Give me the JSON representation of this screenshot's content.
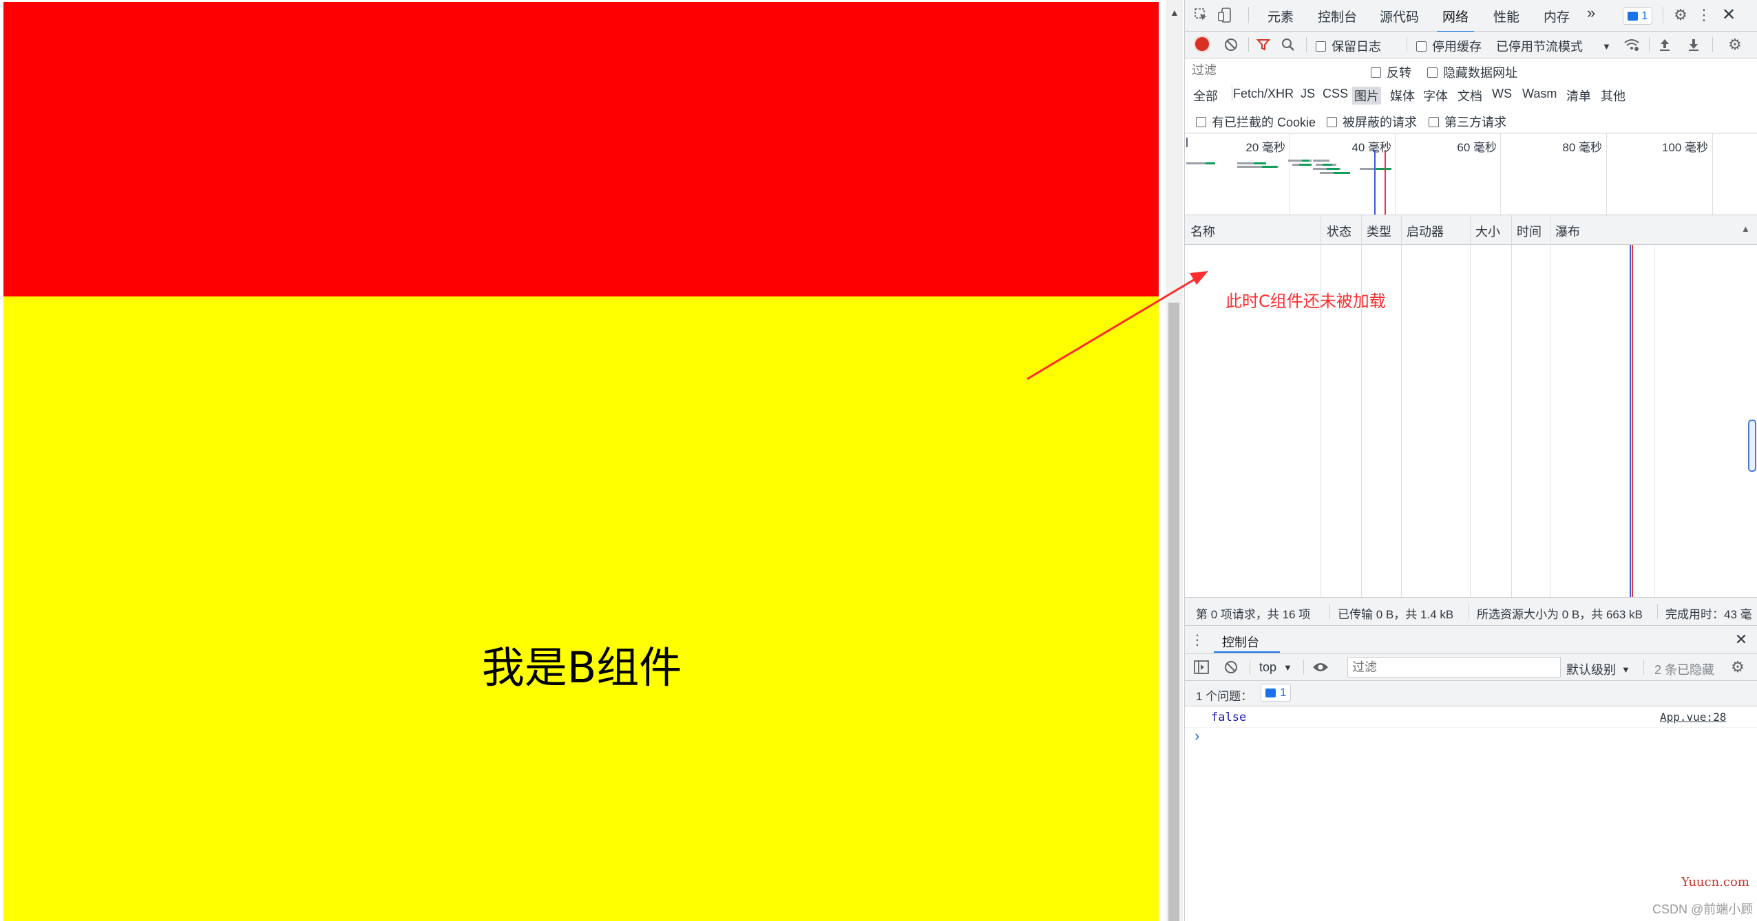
{
  "page": {
    "component_b_text": "我是B组件",
    "colors": {
      "top_block": "#ff0000",
      "bottom_block": "#ffff00"
    }
  },
  "devtools": {
    "tabs": [
      "元素",
      "控制台",
      "源代码",
      "网络",
      "性能",
      "内存"
    ],
    "active_tab": "网络",
    "more_tabs": "»",
    "issues_badge_count": "1",
    "network_toolbar": {
      "preserve_log": "保留日志",
      "disable_cache": "停用缓存",
      "throttling": "已停用节流模式"
    },
    "filter": {
      "placeholder": "过滤",
      "invert": "反转",
      "hide_data_urls": "隐藏数据网址",
      "types": [
        "全部",
        "Fetch/XHR",
        "JS",
        "CSS",
        "图片",
        "媒体",
        "字体",
        "文档",
        "WS",
        "Wasm",
        "清单",
        "其他"
      ],
      "selected_type": "图片",
      "blocked_cookies": "有已拦截的 Cookie",
      "blocked_requests": "被屏蔽的请求",
      "third_party": "第三方请求"
    },
    "overview_ticks": [
      "20 毫秒",
      "40 毫秒",
      "60 毫秒",
      "80 毫秒",
      "100 毫秒"
    ],
    "columns": [
      "名称",
      "状态",
      "类型",
      "启动器",
      "大小",
      "时间",
      "瀑布"
    ],
    "status_bar": {
      "requests": "第 0 项请求，共 16 项",
      "transferred": "已传输 0 B，共 1.4 kB",
      "resources": "所选资源大小为 0 B，共 663 kB",
      "finish": "完成用时：43 毫"
    },
    "console": {
      "drawer_title": "控制台",
      "context": "top",
      "filter_placeholder": "过滤",
      "level": "默认级别",
      "hidden": "2 条已隐藏",
      "issues_label": "1 个问题：",
      "issues_count": "1",
      "log_value": "false",
      "log_source": "App.vue:28",
      "prompt": "›"
    }
  },
  "annotation": "此时C组件还未被加载",
  "watermarks": [
    "Yuucn.com",
    "CSDN @前端小顾"
  ],
  "accent_colors": {
    "active_tab": "#1a73e8",
    "record": "#d93025",
    "filter_icon": "#d93025"
  }
}
